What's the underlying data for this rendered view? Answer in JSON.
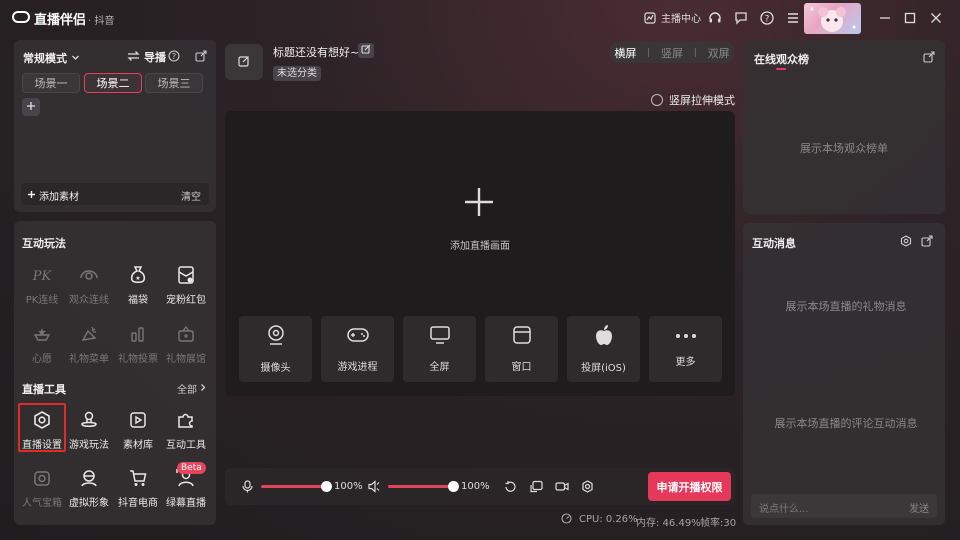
{
  "app": {
    "name": "直播伴侣",
    "sub": "· 抖音",
    "host_center": "主播中心"
  },
  "left_top": {
    "mode": "常规模式",
    "guide": "导播",
    "scenes": [
      "场景一",
      "场景二",
      "场景三"
    ],
    "add_material": "添加素材",
    "clear": "清空"
  },
  "interactive": {
    "title": "互动玩法",
    "items": [
      {
        "label": "PK连线",
        "icon": "pk-icon",
        "enabled": false
      },
      {
        "label": "观众连线",
        "icon": "audience-link-icon",
        "enabled": false
      },
      {
        "label": "福袋",
        "icon": "lucky-bag-icon",
        "enabled": true
      },
      {
        "label": "宠粉红包",
        "icon": "red-packet-icon",
        "enabled": true
      },
      {
        "label": "心愿",
        "icon": "wish-icon",
        "enabled": false
      },
      {
        "label": "礼物菜单",
        "icon": "gift-menu-icon",
        "enabled": false
      },
      {
        "label": "礼物投票",
        "icon": "gift-vote-icon",
        "enabled": false
      },
      {
        "label": "礼物展馆",
        "icon": "gift-hall-icon",
        "enabled": false
      }
    ]
  },
  "tools": {
    "title": "直播工具",
    "all": "全部",
    "items": [
      {
        "label": "直播设置",
        "icon": "live-settings-icon",
        "enabled": true
      },
      {
        "label": "游戏玩法",
        "icon": "game-play-icon",
        "enabled": true
      },
      {
        "label": "素材库",
        "icon": "material-library-icon",
        "enabled": true
      },
      {
        "label": "互动工具",
        "icon": "puzzle-icon",
        "enabled": true
      },
      {
        "label": "人气宝箱",
        "icon": "treasure-box-icon",
        "enabled": false
      },
      {
        "label": "虚拟形象",
        "icon": "avatar-icon",
        "enabled": true
      },
      {
        "label": "抖音电商",
        "icon": "cart-icon",
        "enabled": true
      },
      {
        "label": "绿幕直播",
        "icon": "green-screen-icon",
        "enabled": true
      }
    ],
    "beta": "Beta"
  },
  "center": {
    "title": "标题还没有想好~",
    "category": "未选分类",
    "orientation": [
      "横屏",
      "竖屏",
      "双屏"
    ],
    "stretch": "竖屏拉伸模式",
    "add_screen": "添加直播画面",
    "sources": [
      {
        "label": "摄像头",
        "icon": "camera-icon"
      },
      {
        "label": "游戏进程",
        "icon": "gamepad-icon"
      },
      {
        "label": "全屏",
        "icon": "monitor-icon"
      },
      {
        "label": "窗口",
        "icon": "window-icon"
      },
      {
        "label": "投屏(iOS)",
        "icon": "apple-icon"
      },
      {
        "label": "更多",
        "icon": "more-icon"
      }
    ]
  },
  "audio": {
    "mic": "100%",
    "mic_level": 1.0,
    "speaker": "100%",
    "speaker_level": 1.0
  },
  "go_live": "申请开播权限",
  "stats": {
    "cpu": "CPU: 0.26%",
    "mem": "内存: 46.49%",
    "fps": "帧率:30"
  },
  "right": {
    "viewers_title": "在线观众榜",
    "viewers_placeholder": "展示本场观众榜单",
    "messages_title": "互动消息",
    "gift_placeholder": "展示本场直播的礼物消息",
    "comment_placeholder": "展示本场直播的评论互动消息",
    "input_placeholder": "说点什么...",
    "send": "发送"
  },
  "colors": {
    "accent": "#e6385a",
    "panel": "#343032"
  }
}
